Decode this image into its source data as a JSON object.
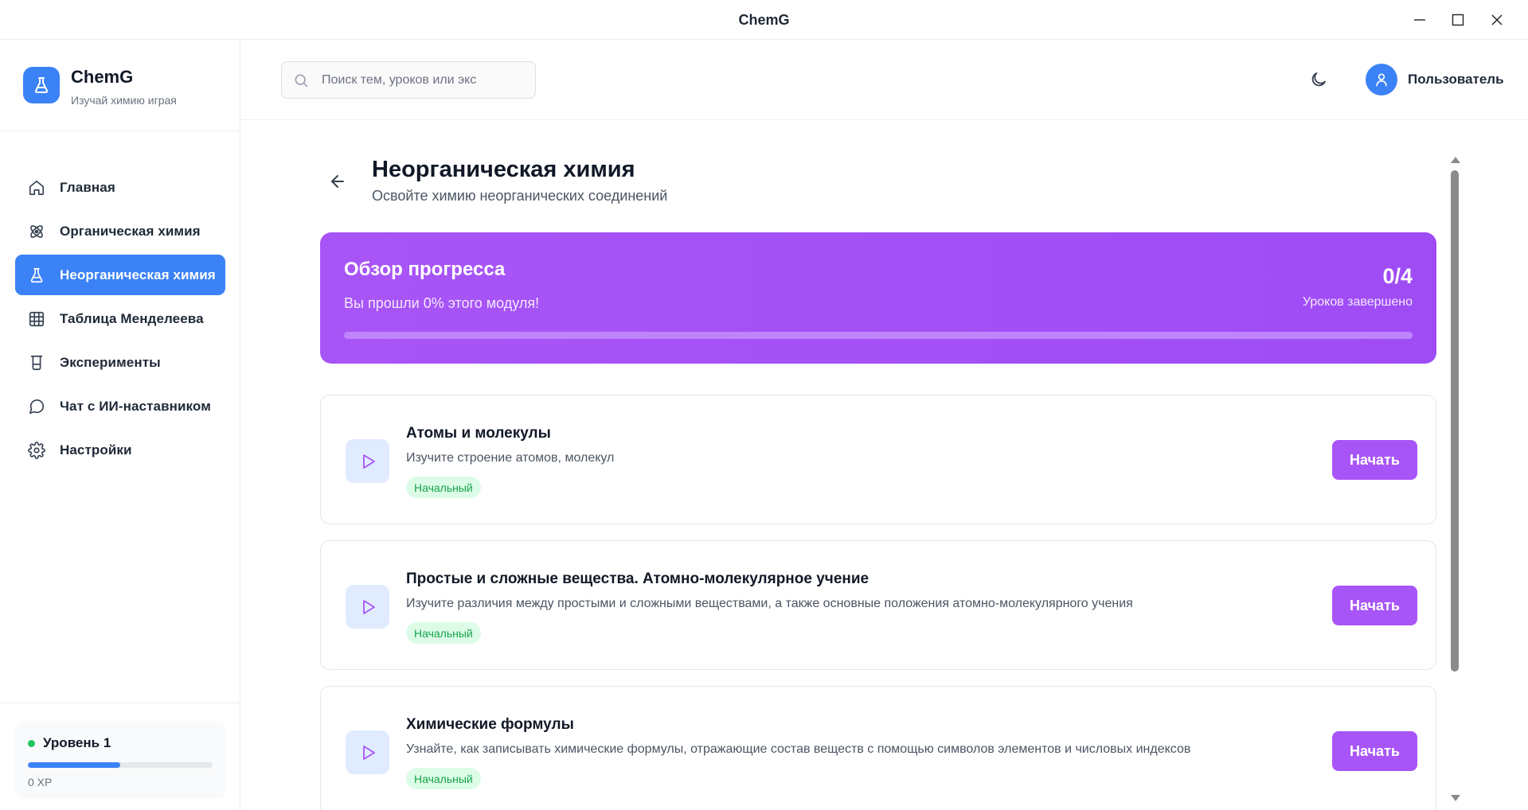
{
  "window": {
    "title": "ChemG"
  },
  "brand": {
    "name": "ChemG",
    "tagline": "Изучай химию играя"
  },
  "nav": {
    "items": [
      {
        "label": "Главная",
        "icon": "home-icon",
        "active": false
      },
      {
        "label": "Органическая химия",
        "icon": "atom-icon",
        "active": false
      },
      {
        "label": "Неорганическая химия",
        "icon": "flask-icon",
        "active": true
      },
      {
        "label": "Таблица Менделеева",
        "icon": "table-icon",
        "active": false
      },
      {
        "label": "Эксперименты",
        "icon": "beaker-icon",
        "active": false
      },
      {
        "label": "Чат с ИИ-наставником",
        "icon": "chat-icon",
        "active": false
      },
      {
        "label": "Настройки",
        "icon": "gear-icon",
        "active": false
      }
    ]
  },
  "level": {
    "label": "Уровень 1",
    "xp": "0 XP",
    "progress": 0.5
  },
  "header": {
    "search_placeholder": "Поиск тем, уроков или экс",
    "theme_icon": "moon-icon",
    "user_name": "Пользователь"
  },
  "page": {
    "title": "Неорганическая химия",
    "subtitle": "Освойте химию неорганических соединений"
  },
  "progress": {
    "title": "Обзор прогресса",
    "subtitle": "Вы прошли 0% этого модуля!",
    "count": "0/4",
    "count_label": "Уроков завершено",
    "percent": 0
  },
  "lessons": [
    {
      "title": "Атомы и молекулы",
      "description": "Изучите строение атомов, молекул",
      "badge": "Начальный",
      "button": "Начать"
    },
    {
      "title": "Простые и сложные вещества. Атомно-молекулярное учение",
      "description": "Изучите различия между простыми и сложными веществами, а также основные положения атомно-молекулярного учения",
      "badge": "Начальный",
      "button": "Начать"
    },
    {
      "title": "Химические формулы",
      "description": "Узнайте, как записывать химические формулы, отражающие состав веществ с помощью символов элементов и числовых индексов",
      "badge": "Начальный",
      "button": "Начать"
    }
  ],
  "colors": {
    "accent_blue": "#3b82f6",
    "accent_purple": "#a855f7",
    "badge_green_bg": "#dcfce7",
    "badge_green_text": "#16a34a",
    "level_dot": "#22c55e"
  }
}
